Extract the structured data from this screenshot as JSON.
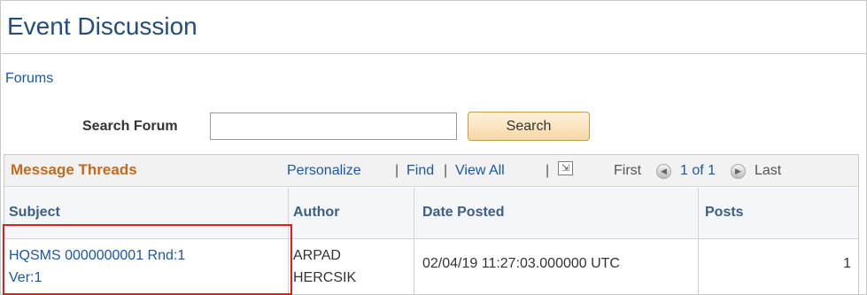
{
  "page": {
    "title": "Event Discussion",
    "forums_link": "Forums"
  },
  "search": {
    "label": "Search Forum",
    "value": "",
    "button": "Search"
  },
  "grid": {
    "title": "Message Threads",
    "nav": {
      "personalize": "Personalize",
      "separator": "|",
      "find": "Find",
      "view_all": "View All",
      "first": "First",
      "page_status": "1 of 1",
      "last": "Last",
      "prev_icon_glyph": "◀",
      "next_icon_glyph": "▶",
      "download_icon_glyph": "⇲"
    },
    "columns": [
      "Subject",
      "Author",
      "Date Posted",
      "Posts"
    ],
    "rows": [
      {
        "subject_line1": "HQSMS 0000000001 Rnd:1",
        "subject_line2": "Ver:1",
        "author_line1": "ARPAD",
        "author_line2": "HERCSIK",
        "date_posted": "02/04/19 11:27:03.000000 UTC",
        "posts": "1"
      }
    ]
  },
  "colors": {
    "title": "#234d7a",
    "link": "#1a57a8",
    "grid_title": "#c36a1f",
    "highlight": "#e11d1d",
    "search_button": "#f6d9a4"
  }
}
